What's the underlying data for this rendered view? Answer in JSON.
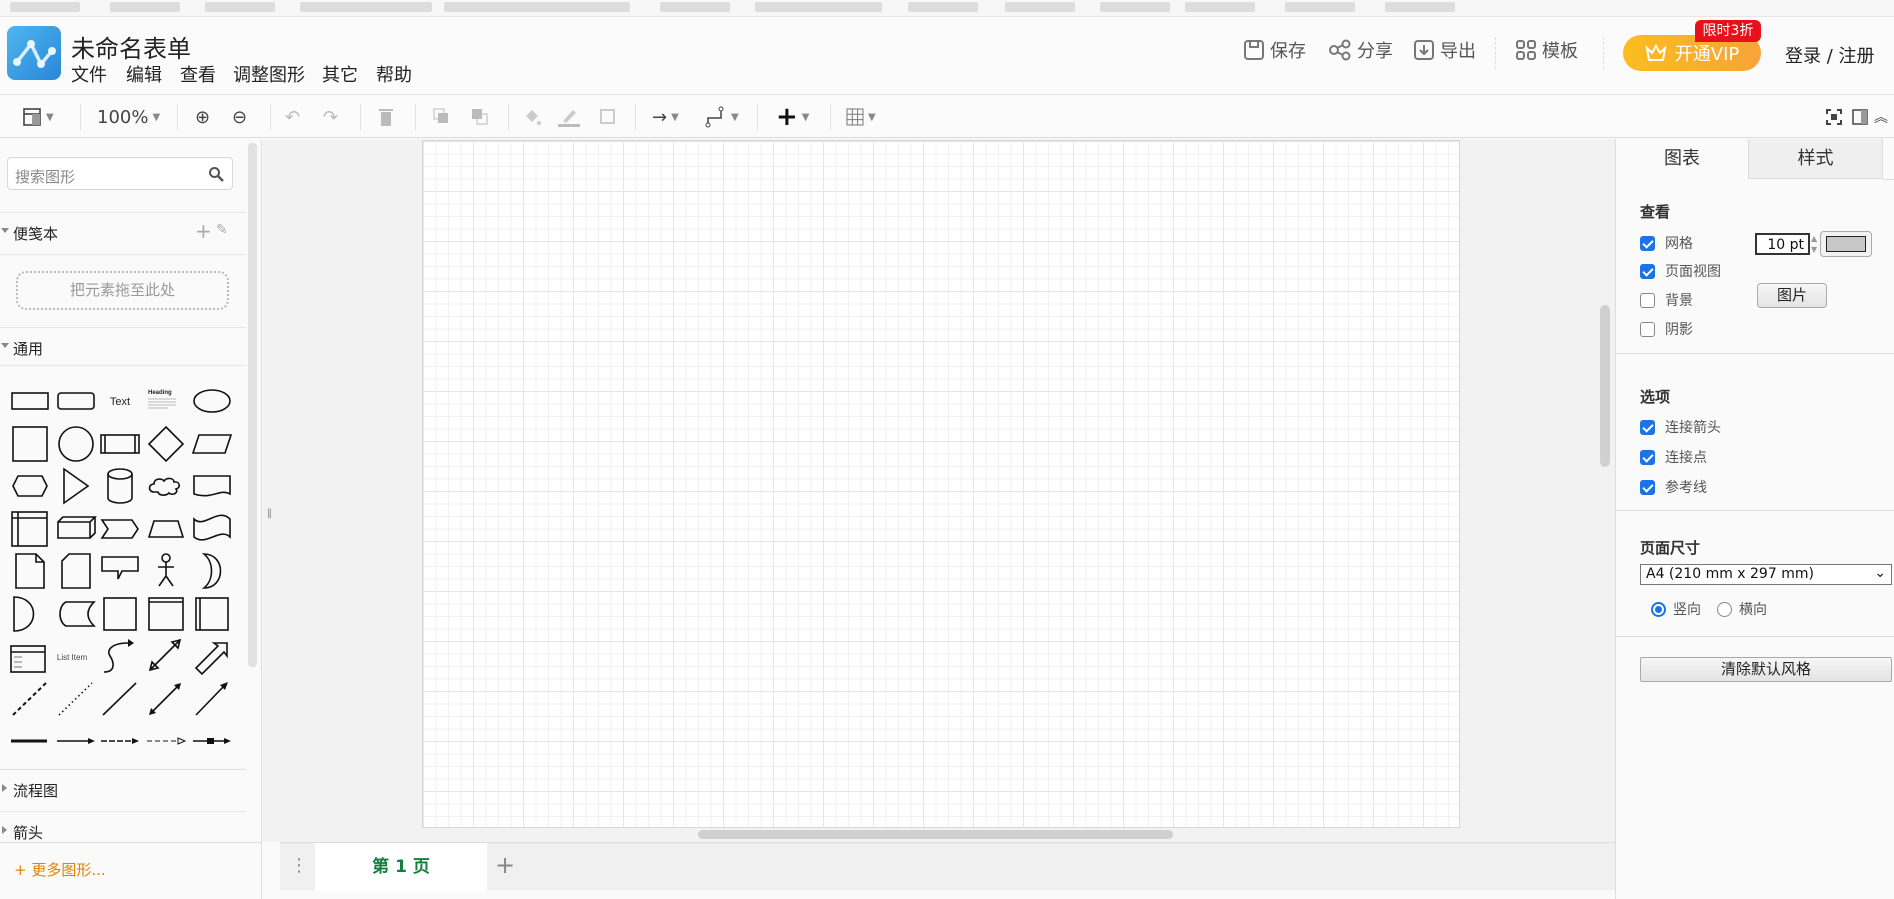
{
  "app": {
    "title": "未命名表单",
    "menu": [
      "文件",
      "编辑",
      "查看",
      "调整图形",
      "其它",
      "帮助"
    ]
  },
  "header_actions": {
    "save": "保存",
    "share": "分享",
    "export": "导出",
    "templates": "模板",
    "vip": "开通VIP",
    "vip_badge": "限时3折",
    "login": "登录 / 注册",
    "vip_color": "#fbbd1e",
    "badge_color": "#e8101a"
  },
  "toolbar": {
    "zoom": "100%",
    "icons": [
      "layout-panel-icon",
      "zoom-in-icon",
      "zoom-out-icon",
      "undo-icon",
      "redo-icon",
      "delete-icon",
      "to-front-icon",
      "to-back-icon",
      "fill-color-icon",
      "line-color-icon",
      "shadow-icon",
      "connection-arrow-icon",
      "waypoint-icon",
      "insert-plus-icon",
      "table-icon",
      "fullscreen-icon",
      "format-panel-icon",
      "collapse-icon"
    ]
  },
  "sidebar": {
    "search_placeholder": "搜索图形",
    "scratchpad": "便笺本",
    "drop_hint": "把元素拖至此处",
    "general": "通用",
    "shape_labels": {
      "text": "Text",
      "heading": "Heading",
      "list_item": "List Item"
    },
    "shapes": [
      "rectangle",
      "rounded-rectangle",
      "text",
      "heading-textbox",
      "ellipse",
      "square",
      "circle",
      "process",
      "diamond",
      "parallelogram",
      "hexagon",
      "triangle",
      "cylinder",
      "cloud",
      "document",
      "internal-storage",
      "cube",
      "step",
      "trapezoid",
      "tape",
      "note",
      "card",
      "callout",
      "actor",
      "or",
      "and",
      "data-storage",
      "container",
      "frame",
      "swimlane",
      "list",
      "list-item",
      "curved-arrow",
      "bidirectional-arrow",
      "single-arrow",
      "dashed-line",
      "dotted-line",
      "line",
      "bidirectional-connector",
      "directional-connector",
      "thick-link",
      "arrow-link",
      "dashed-arrow-link",
      "dashed-arrow-link-2",
      "connector-with-label"
    ],
    "flowchart": "流程图",
    "arrows": "箭头",
    "more_shapes": "+ 更多图形..."
  },
  "pages": {
    "current": "第 1 页"
  },
  "format_panel": {
    "tabs": [
      "图表",
      "样式"
    ],
    "view_heading": "查看",
    "grid": {
      "label": "网格",
      "checked": true,
      "size": "10 pt",
      "color": "#c8c8c8"
    },
    "page_view": {
      "label": "页面视图",
      "checked": true
    },
    "background": {
      "label": "背景",
      "checked": false,
      "image_button": "图片"
    },
    "shadow": {
      "label": "阴影",
      "checked": false
    },
    "options_heading": "选项",
    "connection_arrows": {
      "label": "连接箭头",
      "checked": true
    },
    "connection_points": {
      "label": "连接点",
      "checked": true
    },
    "guides": {
      "label": "参考线",
      "checked": true
    },
    "page_size_heading": "页面尺寸",
    "page_size": "A4 (210 mm x 297 mm)",
    "portrait": {
      "label": "竖向",
      "selected": true
    },
    "landscape": {
      "label": "横向",
      "selected": false
    },
    "clear_style": "清除默认风格"
  }
}
